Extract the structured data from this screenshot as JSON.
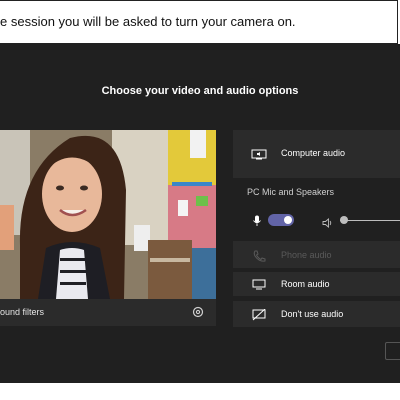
{
  "caption": {
    "text": "e session you will be asked to turn your camera on."
  },
  "dialog": {
    "title": "Choose your video and audio options"
  },
  "preview": {
    "background_filters_label": "ound filters"
  },
  "audio": {
    "computer_audio_label": "Computer audio",
    "device_label": "PC Mic and Speakers",
    "mic_toggle": "on",
    "phone_audio_label": "Phone audio",
    "room_audio_label": "Room audio",
    "dont_use_audio_label": "Don't use audio"
  },
  "colors": {
    "background": "#202020",
    "panel": "#2b2b2b",
    "accent": "#6264a7"
  },
  "icons": [
    "monitor-speaker-icon",
    "microphone-icon",
    "speaker-icon",
    "phone-icon",
    "room-monitor-icon",
    "no-audio-icon",
    "gear-icon"
  ]
}
